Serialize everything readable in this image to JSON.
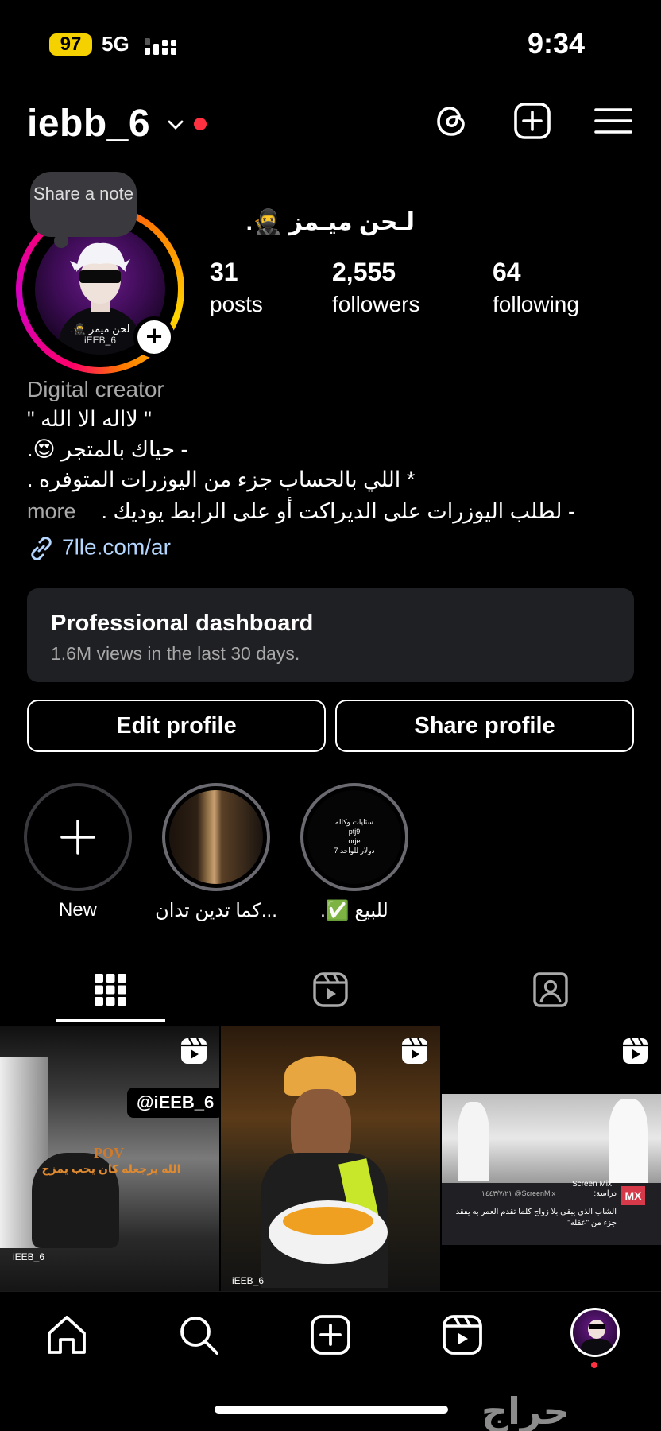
{
  "status_bar": {
    "battery": "97",
    "network": "5G",
    "time": "9:34"
  },
  "header": {
    "username": "iebb_6",
    "icons": [
      "chevron-down-icon",
      "threads-icon",
      "create-icon",
      "menu-icon"
    ]
  },
  "profile": {
    "note": "Share a note",
    "avatar_caption": "لحن ميمز 🥷.",
    "avatar_handle": "iEEB_6",
    "display_name": "لـحن ميـمز 🥷.",
    "stats": {
      "posts": {
        "value": "31",
        "label": "posts"
      },
      "followers": {
        "value": "2,555",
        "label": "followers"
      },
      "following": {
        "value": "64",
        "label": "following"
      }
    },
    "bio": {
      "category": "Digital creator",
      "lines": [
        "\" لااله الا الله \"",
        "- حياك بالمتجر 😍.",
        "* اللي بالحساب جزء من اليوزرات المتوفره .",
        "- لطلب اليوزرات على الديراكت أو على الرابط يوديك ."
      ],
      "more": "more"
    },
    "link": "7lle.com/ar"
  },
  "dashboard": {
    "title": "Professional dashboard",
    "subtitle": "1.6M views in the last 30 days."
  },
  "buttons": {
    "edit": "Edit profile",
    "share": "Share profile"
  },
  "highlights": [
    {
      "label": "New"
    },
    {
      "label": "كما تدين تدان..."
    },
    {
      "label": "للبيع ✅.",
      "cover_text": [
        "ستايات وكاله",
        "ptj9",
        "orje",
        "7 دولار للواحد"
      ]
    }
  ],
  "tabs": [
    "grid-icon",
    "reels-icon",
    "tagged-icon"
  ],
  "posts": [
    {
      "overlay_tag": "@iEEB_6",
      "title": "POV",
      "caption": "الله يرجعله كان يحب يمزح",
      "watermark": "iEEB_6"
    },
    {
      "watermark": "iEEB_6"
    },
    {
      "source": "Screen Mix",
      "date": "١٤٤٣/٧/٢١ @ScreenMix",
      "study": "دراسة:",
      "caption": "الشاب الذي يبقى بلا زواج كلما تقدم العمر به يفقد جزء من \"عقله\"",
      "logo": "MX"
    }
  ],
  "nav": [
    "home-icon",
    "search-icon",
    "create-icon",
    "reels-icon",
    "profile-avatar"
  ],
  "watermark": "حراج"
}
